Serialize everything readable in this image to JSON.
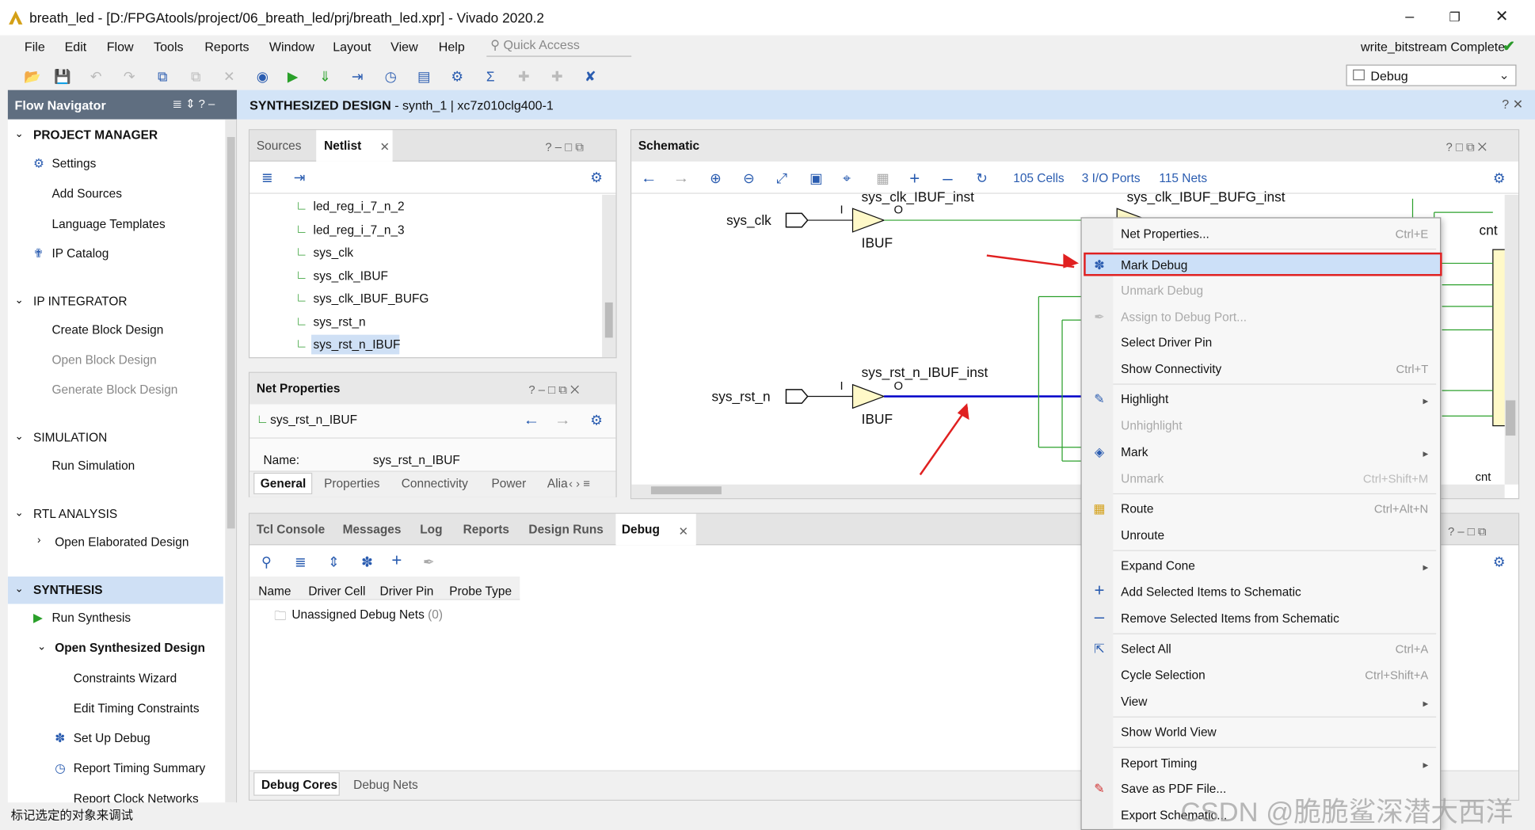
{
  "window": {
    "title": "breath_led - [D:/FPGAtools/project/06_breath_led/prj/breath_led.xpr] - Vivado 2020.2",
    "status": "write_bitstream Complete"
  },
  "menu": [
    "File",
    "Edit",
    "Flow",
    "Tools",
    "Reports",
    "Window",
    "Layout",
    "View",
    "Help"
  ],
  "quick_access_placeholder": "Quick Access",
  "layout_select": "Debug",
  "flow_navigator": {
    "title": "Flow Navigator",
    "project_manager": "PROJECT MANAGER",
    "pm_items": [
      "Settings",
      "Add Sources",
      "Language Templates",
      "IP Catalog"
    ],
    "ip_integrator": "IP INTEGRATOR",
    "ipi_items": [
      "Create Block Design",
      "Open Block Design",
      "Generate Block Design"
    ],
    "simulation": "SIMULATION",
    "sim_items": [
      "Run Simulation"
    ],
    "rtl": "RTL ANALYSIS",
    "rtl_items": [
      "Open Elaborated Design"
    ],
    "synthesis": "SYNTHESIS",
    "syn_items": [
      "Run Synthesis",
      "Open Synthesized Design",
      "Constraints Wizard",
      "Edit Timing Constraints",
      "Set Up Debug",
      "Report Timing Summary",
      "Report Clock Networks"
    ]
  },
  "synth_header": {
    "title": "SYNTHESIZED DESIGN",
    "detail": " - synth_1 | xc7z010clg400-1"
  },
  "netlist": {
    "tabs": [
      "Sources",
      "Netlist"
    ],
    "items": [
      "led_reg_i_7_n_2",
      "led_reg_i_7_n_3",
      "sys_clk",
      "sys_clk_IBUF",
      "sys_clk_IBUF_BUFG",
      "sys_rst_n",
      "sys_rst_n_IBUF"
    ]
  },
  "net_properties": {
    "title": "Net Properties",
    "net": "sys_rst_n_IBUF",
    "name_label": "Name:",
    "name_value": "sys_rst_n_IBUF",
    "tabs": [
      "General",
      "Properties",
      "Connectivity",
      "Power",
      "Alia"
    ]
  },
  "schematic": {
    "title": "Schematic",
    "cells": "105 Cells",
    "ports": "3 I/O Ports",
    "nets": "115 Nets",
    "labels": {
      "sys_clk": "sys_clk",
      "sys_rst_n": "sys_rst_n",
      "ibuf1_inst": "sys_clk_IBUF_inst",
      "ibuf2_inst": "sys_rst_n_IBUF_inst",
      "ibuf": "IBUF",
      "bufg_inst": "sys_clk_IBUF_BUFG_inst",
      "pin_i": "I",
      "pin_o": "O",
      "cnt": "cnt",
      "cnt2": "cnt"
    }
  },
  "bottom_panel": {
    "tabs": [
      "Tcl Console",
      "Messages",
      "Log",
      "Reports",
      "Design Runs",
      "Debug"
    ],
    "columns": [
      "Name",
      "Driver Cell",
      "Driver Pin",
      "Probe Type"
    ],
    "row": "Unassigned Debug Nets",
    "row_count": "(0)",
    "bottom_tabs": [
      "Debug Cores",
      "Debug Nets"
    ]
  },
  "context_menu": [
    {
      "label": "Net Properties...",
      "shortcut": "Ctrl+E"
    },
    {
      "label": "Mark Debug",
      "highlighted": true
    },
    {
      "label": "Unmark Debug",
      "disabled": true
    },
    {
      "label": "Assign to Debug Port...",
      "disabled": true
    },
    {
      "label": "Select Driver Pin"
    },
    {
      "label": "Show Connectivity",
      "shortcut": "Ctrl+T"
    },
    {
      "label": "Highlight",
      "submenu": true
    },
    {
      "label": "Unhighlight",
      "disabled": true
    },
    {
      "label": "Mark",
      "submenu": true
    },
    {
      "label": "Unmark",
      "shortcut": "Ctrl+Shift+M",
      "disabled": true
    },
    {
      "label": "Route",
      "shortcut": "Ctrl+Alt+N"
    },
    {
      "label": "Unroute"
    },
    {
      "label": "Expand Cone",
      "submenu": true
    },
    {
      "label": "Add Selected Items to Schematic"
    },
    {
      "label": "Remove Selected Items from Schematic"
    },
    {
      "label": "Select All",
      "shortcut": "Ctrl+A"
    },
    {
      "label": "Cycle Selection",
      "shortcut": "Ctrl+Shift+A"
    },
    {
      "label": "View",
      "submenu": true
    },
    {
      "label": "Show World View"
    },
    {
      "label": "Report Timing",
      "submenu": true
    },
    {
      "label": "Save as PDF File..."
    },
    {
      "label": "Export Schematic..."
    }
  ],
  "status_bar": "标记选定的对象来调试",
  "watermark": "CSDN @脆脆鲨深潜大西洋",
  "colors": {
    "accent": "#2a5cb0",
    "selected_net": "#0000c8",
    "highlight_red": "#e02020",
    "flow_header": "#5f6e80"
  }
}
